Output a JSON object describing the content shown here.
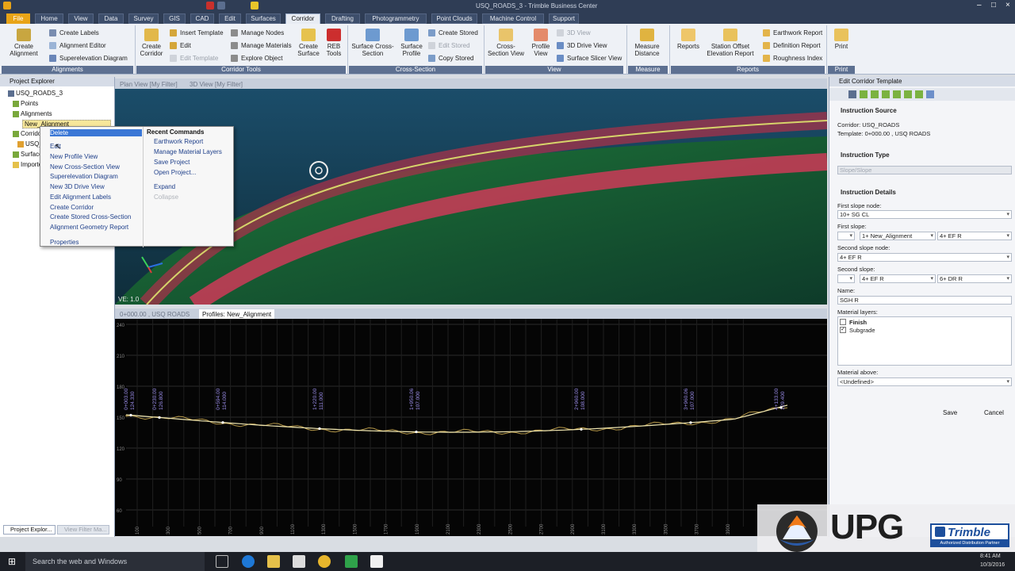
{
  "window": {
    "title": "USQ_ROADS_3 - Trimble Business Center"
  },
  "tabs": [
    "File",
    "Home",
    "View",
    "Data",
    "Survey",
    "GIS",
    "CAD",
    "Edit",
    "Surfaces",
    "Corridor",
    "Drafting",
    "Photogrammetry",
    "Point Clouds",
    "Machine Control",
    "Support"
  ],
  "active_tab": "Corridor",
  "ribbon": {
    "create_alignment": "Create Alignment",
    "create_labels": "Create Labels",
    "alignment_editor": "Alignment Editor",
    "superelevation_diagram": "Superelevation Diagram",
    "group_alignments": "Alignments",
    "create_corridor": "Create Corridor",
    "insert_template": "Insert Template",
    "edit": "Edit",
    "edit_template": "Edit Template",
    "manage_nodes": "Manage Nodes",
    "manage_materials": "Manage Materials",
    "explore_object": "Explore Object",
    "create_surface": "Create Surface",
    "reb_tools": "REB Tools",
    "group_corridor_tools": "Corridor Tools",
    "surface_cross_section": "Surface Cross-Section",
    "surface_profile": "Surface Profile",
    "create_stored": "Create Stored",
    "edit_stored": "Edit Stored",
    "copy_stored": "Copy Stored",
    "group_cross_section": "Cross-Section",
    "cross_section_view": "Cross-Section View",
    "profile_view": "Profile View",
    "view_3d": "3D View",
    "drive_view_3d": "3D Drive View",
    "surface_slicer_view": "Surface Slicer View",
    "group_view": "View",
    "measure_distance": "Measure Distance",
    "group_measure": "Measure",
    "reports": "Reports",
    "station_offset": "Station Offset Elevation Report",
    "earthwork_report": "Earthwork Report",
    "definition_report": "Definition Report",
    "roughness_index": "Roughness Index",
    "group_reports": "Reports",
    "print": "Print",
    "group_print": "Print"
  },
  "project_explorer": {
    "title": "Project Explorer",
    "root": "USQ_ROADS_3",
    "points": "Points",
    "alignments": "Alignments",
    "selected": "New_Alignment",
    "corridors": "Corrido",
    "corridor_child": "USQ_",
    "surfaces": "Surface",
    "imported": "Importe",
    "bottom_tab_1": "Project Explor...",
    "bottom_tab_2": "View Filter Ma..."
  },
  "context_menu": {
    "left_items": [
      "Delete",
      "Edit",
      "New Profile View",
      "New Cross-Section View",
      "Superelevation Diagram",
      "New 3D Drive View",
      "Edit Alignment Labels",
      "Create Corridor",
      "Create Stored Cross-Section",
      "Alignment Geometry Report",
      "Properties"
    ],
    "recent_header": "Recent Commands",
    "recent_items": [
      "Earthwork Report",
      "Manage Material Layers",
      "Save Project",
      "Open Project..."
    ],
    "expand": "Expand",
    "collapse": "Collapse"
  },
  "plan_view": {
    "tab1": "Plan View [My Filter]",
    "tab2": "3D View [My Filter]",
    "ve_label": "VE: 1.0"
  },
  "profile_view": {
    "tab1": "0+000.00 , USQ ROADS",
    "tab2": "Profiles: New_Alignment",
    "y_ticks": [
      "240",
      "210",
      "180",
      "150",
      "120",
      "90",
      "60",
      "30"
    ],
    "x_ticks": [
      "100",
      "200",
      "300",
      "400",
      "500",
      "600",
      "700",
      "800",
      "900",
      "1000",
      "1100",
      "1200",
      "1300",
      "1400",
      "1500",
      "1600",
      "1700",
      "1800",
      "1900",
      "2000",
      "2100",
      "2200",
      "2300",
      "2400",
      "2500",
      "2600",
      "2700",
      "2800",
      "2900",
      "3000",
      "3100",
      "3200",
      "3300",
      "3400",
      "3500",
      "3600",
      "3700",
      "3800",
      "3900",
      "4000"
    ],
    "annotations": [
      "0+003.00\n124.330",
      "0+230.00\n126.800",
      "0+594.00\n114.000",
      "1+220.00\n111.000",
      "1+950.06\n107.000",
      "2+960.00\n108.000",
      "3+960.06\n107.000",
      "4+133.00\n129.400"
    ]
  },
  "edit_corridor_template": {
    "title": "Edit Corridor Template",
    "instruction_source": "Instruction Source",
    "corridor": "Corridor: USQ_ROADS",
    "template": "Template: 0+000.00 , USQ ROADS",
    "instruction_type": "Instruction Type",
    "type_value": "Slope/Slope",
    "instruction_details": "Instruction Details",
    "first_slope_node_label": "First slope node:",
    "first_slope_node": "10+ SG CL",
    "first_slope_label": "First slope:",
    "first_slope_a": "1+ New_Alignment",
    "first_slope_b": "4+ EF R",
    "second_slope_node_label": "Second slope node:",
    "second_slope_node": "4+ EF R",
    "second_slope_label": "Second slope:",
    "second_slope_a": "4+ EF R",
    "second_slope_b": "6+ DR R",
    "name_label": "Name:",
    "name_value": "SGH R",
    "material_layers_label": "Material layers:",
    "layer_finish": "Finish",
    "layer_subgrade": "Subgrade",
    "material_above_label": "Material above:",
    "material_above": "<Undefined>",
    "save": "Save",
    "cancel": "Cancel"
  },
  "taskbar": {
    "search": "Search the web and Windows",
    "time": "8:41 AM",
    "date": "10/3/2016"
  },
  "logo": {
    "upg": "UPG",
    "trimble": "Trimble",
    "sub": "Authorized Distribution Partner"
  },
  "colors": {
    "file_tab": "#e8a417",
    "title_bar": "#2f3d55",
    "corridor_red": "#d8385a",
    "terrain_green": "#1f7a3a"
  }
}
